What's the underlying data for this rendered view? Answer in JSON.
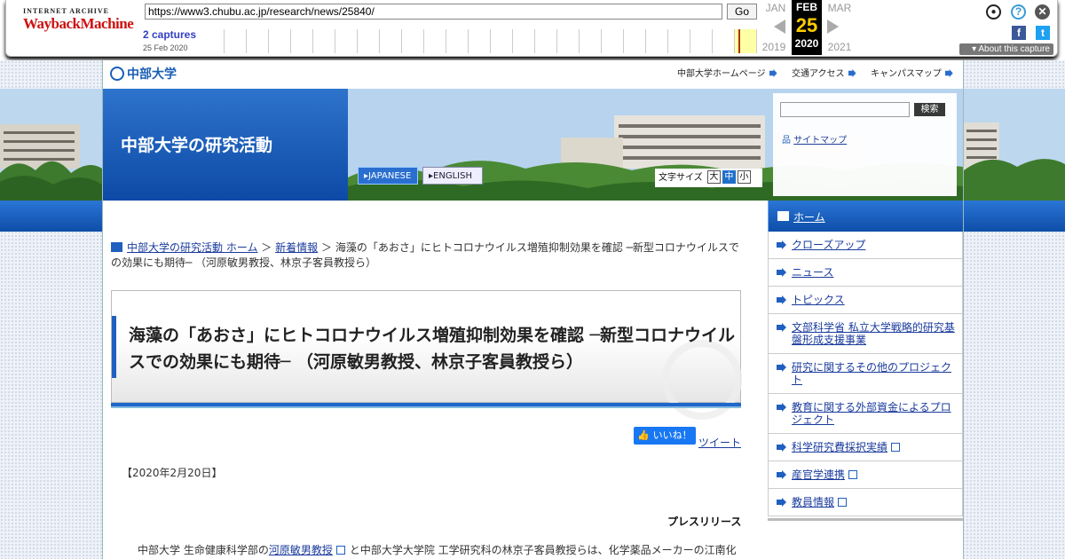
{
  "wayback": {
    "logo_line1": "INTERNET ARCHIVE",
    "logo_line2": "WaybackMachine",
    "url": "https://www3.chubu.ac.jp/research/news/25840/",
    "go_label": "Go",
    "captures": "2 captures",
    "capture_date": "25 Feb 2020",
    "prev_month": "JAN",
    "cur_month": "FEB",
    "next_month": "MAR",
    "cur_day": "25",
    "prev_year": "2019",
    "cur_year": "2020",
    "next_year": "2021",
    "about": "About this capture"
  },
  "site": {
    "logo": "中部大学",
    "top_links": [
      "中部大学ホームページ",
      "交通アクセス",
      "キャンパスマップ"
    ],
    "header_title": "中部大学の研究活動",
    "lang_jp": "JAPANESE",
    "lang_en": "ENGLISH",
    "font_size_label": "文字サイズ",
    "font_sizes": [
      "大",
      "中",
      "小"
    ],
    "search_button": "検索",
    "sitemap": "サイトマップ"
  },
  "sidebar": {
    "home": "ホーム",
    "items": [
      "クローズアップ",
      "ニュース",
      "トピックス",
      "文部科学省 私立大学戦略的研究基盤形成支援事業",
      "研究に関するその他のプロジェクト",
      "教育に関する外部資金によるプロジェクト",
      "科学研究費採択実績",
      "産官学連携",
      "教員情報"
    ]
  },
  "breadcrumb": {
    "home": "中部大学の研究活動 ホーム",
    "section": "新着情報",
    "sep": "＞",
    "current": "海藻の「あおさ」にヒトコロナウイルス増殖抑制効果を確認 ─新型コロナウイルスでの効果にも期待─ （河原敏男教授、林京子客員教授ら）"
  },
  "article": {
    "title": "海藻の「あおさ」にヒトコロナウイルス増殖抑制効果を確認 ─新型コロナウイルスでの効果にも期待─ （河原敏男教授、林京子客員教授ら）",
    "like": "いいね！",
    "tweet": "ツイート",
    "date": "【2020年2月20日】",
    "press": "プレスリリース",
    "para_prefix": "中部大学 生命健康科学部の",
    "para_link": "河原敏男教授",
    "para_rest": "と中部大学大学院 工学研究科の林京子客員教授らは、化学薬品メーカーの江南化"
  }
}
